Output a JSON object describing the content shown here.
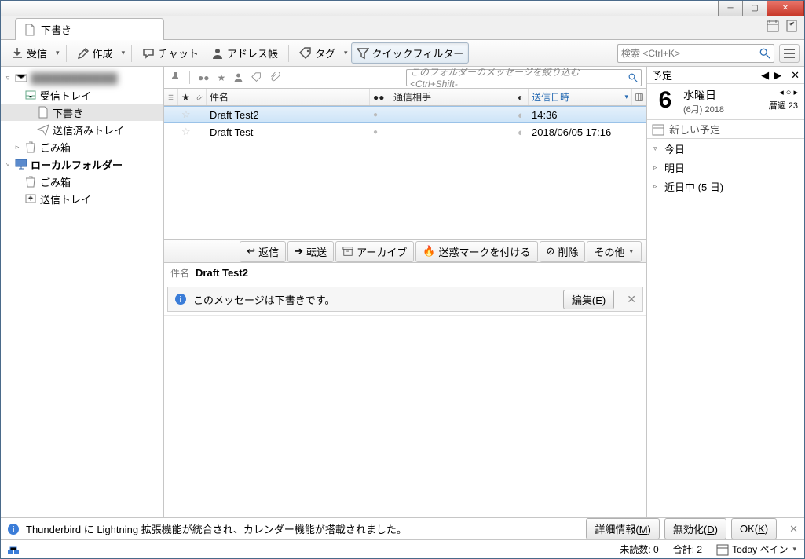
{
  "tab": {
    "title": "下書き"
  },
  "toolbar": {
    "receive": "受信",
    "compose": "作成",
    "chat": "チャット",
    "addressbook": "アドレス帳",
    "tag": "タグ",
    "quickfilter": "クイックフィルター",
    "search_placeholder": "検索 <Ctrl+K>"
  },
  "folders": {
    "inbox": "受信トレイ",
    "drafts": "下書き",
    "sent": "送信済みトレイ",
    "trash": "ごみ箱",
    "local": "ローカルフォルダー",
    "local_trash": "ごみ箱",
    "outbox": "送信トレイ"
  },
  "filter": {
    "placeholder": "このフォルダーのメッセージを絞り込む <Ctrl+Shift-"
  },
  "columns": {
    "subject": "件名",
    "correspondent": "通信相手",
    "date": "送信日時"
  },
  "messages": [
    {
      "subject": "Draft Test2",
      "correspondent": "",
      "date": "14:36"
    },
    {
      "subject": "Draft Test",
      "correspondent": "",
      "date": "2018/06/05 17:16"
    }
  ],
  "preview": {
    "reply": "返信",
    "forward": "転送",
    "archive": "アーカイブ",
    "junk": "迷惑マークを付ける",
    "delete": "削除",
    "other": "その他",
    "subject_label": "件名",
    "subject": "Draft Test2",
    "draft_notice": "このメッセージは下書きです。",
    "edit": "編集(E)"
  },
  "calendar": {
    "header": "予定",
    "daynum": "6",
    "dow": "水曜日",
    "month_year": "(6月) 2018",
    "week": "暦週 23",
    "new_event": "新しい予定",
    "today": "今日",
    "tomorrow": "明日",
    "soon": "近日中 (5 日)"
  },
  "lightning": {
    "text": "Thunderbird に Lightning 拡張機能が統合され、カレンダー機能が搭載されました。",
    "more": "詳細情報(M)",
    "disable": "無効化(D)",
    "ok": "OK(K)"
  },
  "status": {
    "unread_label": "未読数:",
    "unread": "0",
    "total_label": "合計:",
    "total": "2",
    "today_pane": "Today ペイン"
  }
}
